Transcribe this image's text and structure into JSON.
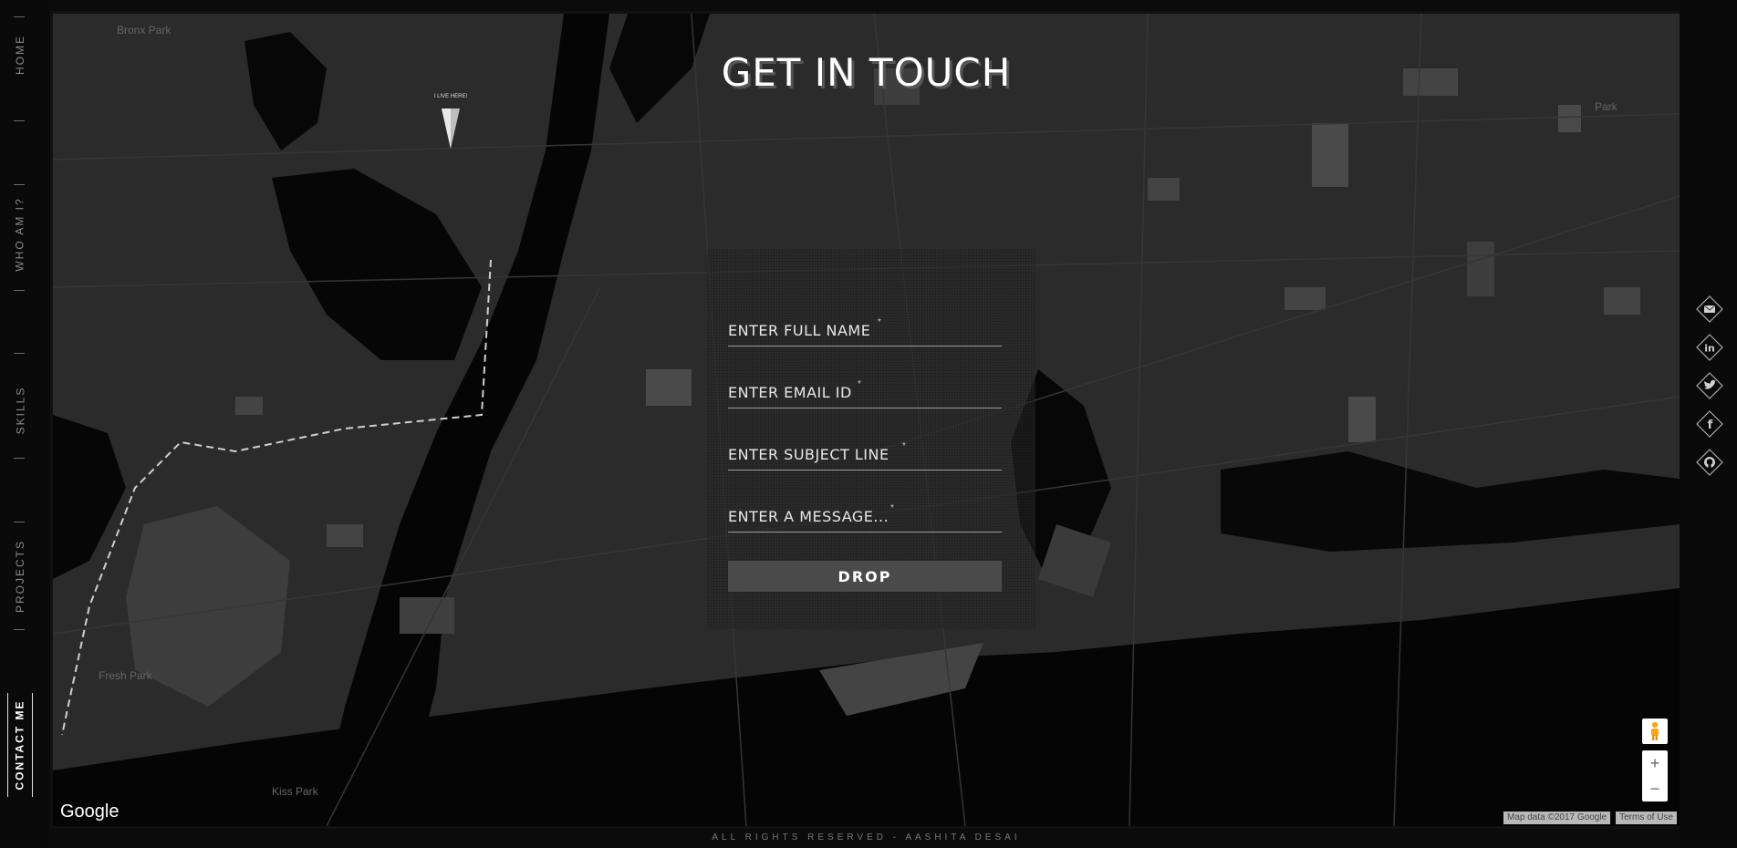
{
  "nav": {
    "items": [
      {
        "label": "HOME",
        "active": false
      },
      {
        "label": "WHO AM I?",
        "active": false
      },
      {
        "label": "SKILLS",
        "active": false
      },
      {
        "label": "PROJECTS",
        "active": false
      },
      {
        "label": "CONTACT ME",
        "active": true
      }
    ]
  },
  "title": "GET IN TOUCH",
  "form": {
    "name_placeholder": "ENTER FULL NAME",
    "email_placeholder": "ENTER EMAIL ID",
    "subject_placeholder": "ENTER SUBJECT LINE",
    "message_placeholder": "ENTER A MESSAGE...",
    "required_mark": "*",
    "submit_label": "DROP"
  },
  "map": {
    "pin_label": "I LIVE HERE!",
    "google_label": "Google",
    "attribution": "Map data ©2017 Google",
    "terms": "Terms of Use",
    "zoom_in": "+",
    "zoom_out": "−",
    "place_labels": [
      "Bronx Park",
      "Fresh Park",
      "Kiss Park",
      "Park"
    ]
  },
  "social": {
    "icons": [
      "envelope-icon",
      "linkedin-icon",
      "twitter-icon",
      "facebook-icon",
      "github-icon"
    ]
  },
  "footer": "ALL RIGHTS RESERVED - AASHITA DESAI",
  "colors": {
    "background": "#0b0b0b",
    "map_land": "#2a2a2a",
    "map_water": "#050505",
    "map_park": "#4a4a4a",
    "text": "#ffffff"
  }
}
